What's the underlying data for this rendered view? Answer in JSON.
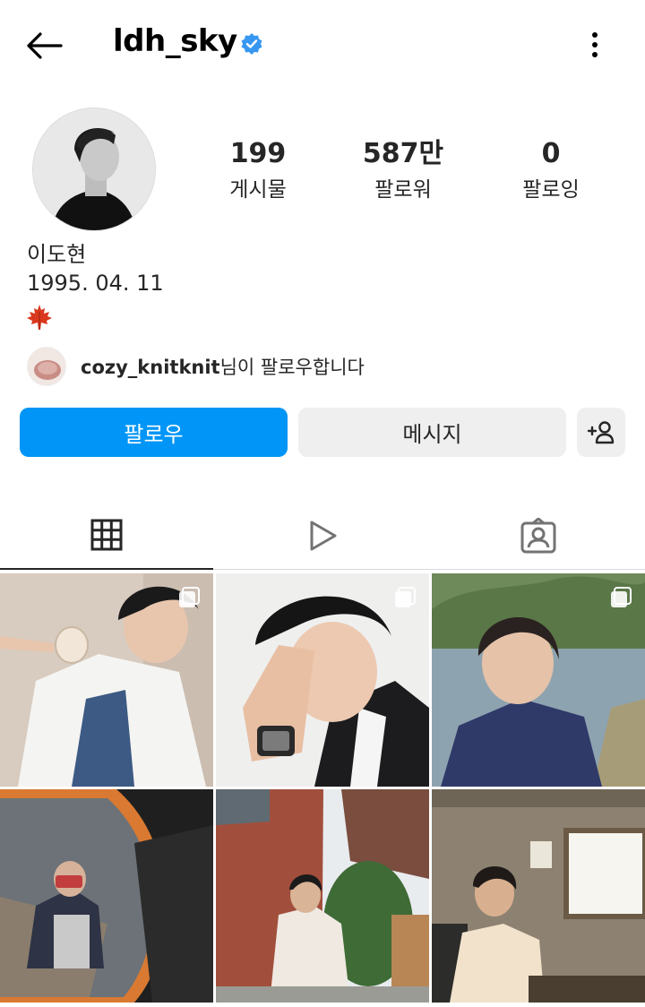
{
  "header": {
    "username": "ldh_sky",
    "back_icon": "arrow-left-icon",
    "verified_icon": "verified-badge-icon",
    "more_icon": "more-vertical-icon",
    "verified_color": "#3897f0"
  },
  "profile": {
    "stats": {
      "posts_count": "199",
      "posts_label": "게시물",
      "followers_count": "587만",
      "followers_label": "팔로워",
      "following_count": "0",
      "following_label": "팔로잉"
    },
    "name": "이도현",
    "bio_line": "1995. 04. 11",
    "bio_emoji_icon": "maple-leaf-icon",
    "followed_by": {
      "username": "cozy_knitknit",
      "suffix": "님이 팔로우합니다"
    }
  },
  "actions": {
    "follow_label": "팔로우",
    "message_label": "메시지",
    "suggest_icon": "add-person-icon",
    "follow_color": "#0095f6"
  },
  "tabs": [
    {
      "icon": "grid-icon",
      "active": true
    },
    {
      "icon": "reels-play-icon",
      "active": false
    },
    {
      "icon": "tagged-person-icon",
      "active": false
    }
  ]
}
